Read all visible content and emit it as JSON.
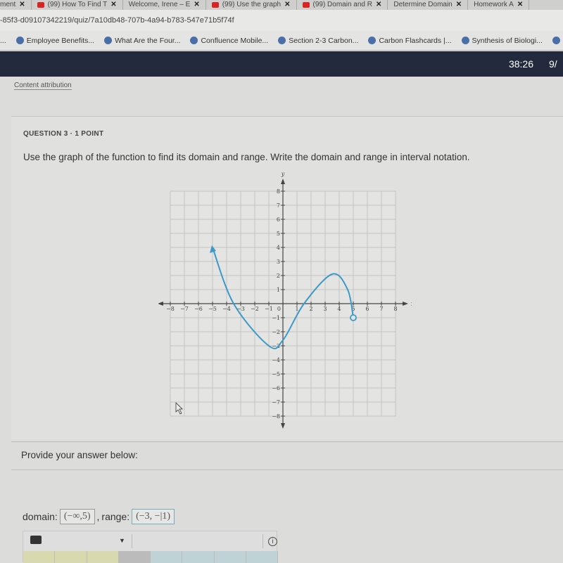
{
  "browser": {
    "tabs": [
      {
        "label": "ment",
        "icon": "page-icon"
      },
      {
        "label": "(99) How To Find T",
        "icon": "youtube-icon"
      },
      {
        "label": "Welcome, Irene – E",
        "icon": "bb-icon"
      },
      {
        "label": "(99) Use the graph",
        "icon": "youtube-icon"
      },
      {
        "label": "(99) Domain and R",
        "icon": "youtube-icon"
      },
      {
        "label": "Determine Domain",
        "icon": "page-icon"
      },
      {
        "label": "Homework A",
        "icon": "page-icon"
      }
    ],
    "url": "-85f3-d09107342219/quiz/7a10db48-707b-4a94-b783-547e71b5f74f",
    "bookmarks": [
      "...",
      "Employee Benefits...",
      "What Are the Four...",
      "Confluence Mobile...",
      "Section 2-3 Carbon...",
      "Carbon Flashcards |...",
      "Synthesis of Biologi...",
      "Carbo"
    ]
  },
  "header": {
    "timer": "38:26",
    "page": "9/"
  },
  "content_attribution": "Content attribution",
  "question": {
    "number": "QUESTION 3 · 1 POINT",
    "text": "Use the graph of the function to find its domain and range. Write the domain and range in interval notation."
  },
  "chart_data": {
    "type": "line",
    "xlabel": "x",
    "ylabel": "y",
    "xlim": [
      -8,
      8
    ],
    "ylim": [
      -8,
      8
    ],
    "xticks": [
      -8,
      -7,
      -6,
      -5,
      -4,
      -3,
      -2,
      -1,
      1,
      2,
      3,
      4,
      5,
      6,
      7,
      8
    ],
    "yticks": [
      -8,
      -7,
      -6,
      -5,
      -4,
      -3,
      -2,
      -1,
      1,
      2,
      3,
      4,
      5,
      6,
      7,
      8
    ],
    "origin_label": "0",
    "grid": true,
    "color": "#3d9ac8",
    "points": [
      [
        -5,
        4
      ],
      [
        -3.5,
        0
      ],
      [
        -1,
        -3
      ],
      [
        0,
        -2.6
      ],
      [
        1.5,
        0
      ],
      [
        3.5,
        2.1
      ],
      [
        4.6,
        1
      ],
      [
        5,
        -1
      ]
    ],
    "start": {
      "x": -5,
      "y": 4,
      "marker": "arrow"
    },
    "end": {
      "x": 5,
      "y": -1,
      "marker": "open-circle"
    }
  },
  "answer": {
    "prompt": "Provide your answer below:",
    "domain_label": "domain:",
    "domain_value": "(−∞,5)",
    "separator": ",",
    "range_label": "range:",
    "range_value": "(−3, −|1)"
  }
}
